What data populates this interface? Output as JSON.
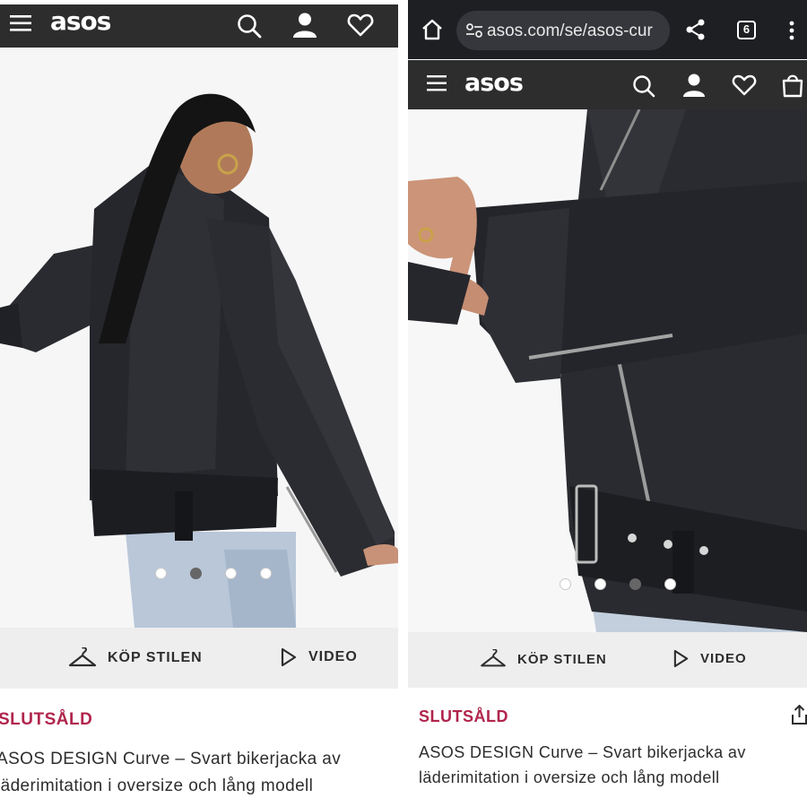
{
  "brand": {
    "logo_text": "asos"
  },
  "browser": {
    "url": "asos.com/se/asos-cur",
    "tab_count": "6",
    "icons": [
      "home-icon",
      "site-settings-icon",
      "share-icon",
      "tabs-icon",
      "more-options-icon"
    ]
  },
  "header": {
    "icons": [
      "menu-icon",
      "search-icon",
      "account-icon",
      "wishlist-icon",
      "bag-icon"
    ]
  },
  "gallery": {
    "left": {
      "image_count": 4,
      "active_index": 1
    },
    "right": {
      "image_count": 4,
      "active_index": 2
    }
  },
  "actions": {
    "shop_the_look": "KÖP STILEN",
    "video": "VIDEO"
  },
  "product": {
    "status": "SLUTSÅLD",
    "status_color": "#b0254c",
    "title_line1": "ASOS DESIGN Curve – Svart bikerjacka av",
    "title_line2": "läderimitation i oversize och lång modell"
  },
  "colors": {
    "header_bg": "#2d2d2d",
    "browser_bg": "#1e1f22",
    "action_bar_bg": "#eeeeee"
  }
}
